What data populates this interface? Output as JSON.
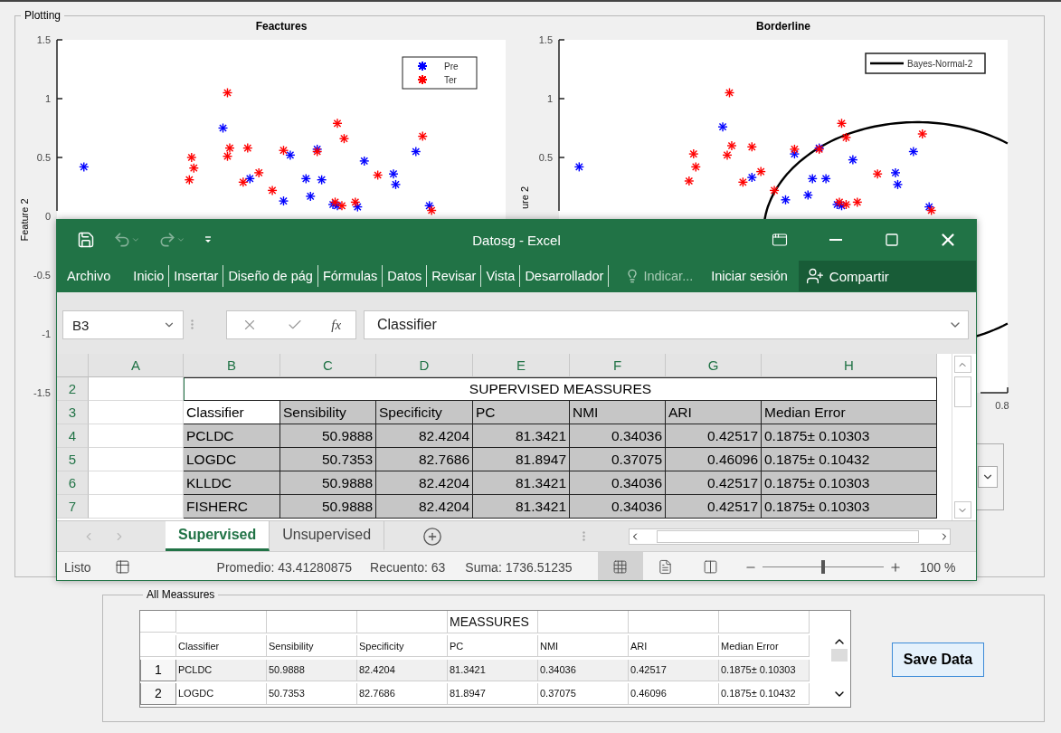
{
  "plotting": {
    "legend": "Plotting",
    "plots": [
      {
        "title": "Feactures",
        "ylabel": "Feature 2",
        "yticks": [
          "1.5",
          "1",
          "0.5",
          "0",
          "-0.5",
          "-1",
          "-1.5"
        ],
        "legend": [
          {
            "kind": "marker",
            "label": "Pre",
            "color": "#0000ff"
          },
          {
            "kind": "marker",
            "label": "Ter",
            "color": "#ff0000"
          }
        ]
      },
      {
        "title": "Borderline",
        "ylabel": "ure 2",
        "yticks": [
          "1.5",
          "1",
          "0.5"
        ],
        "xtick": "0.8",
        "legend": [
          {
            "kind": "line",
            "label": "Bayes-Normal-2"
          }
        ]
      }
    ]
  },
  "excel": {
    "title": "Datosg - Excel",
    "ribbon_tabs": [
      "Inicio",
      "Insertar",
      "Diseño de pág",
      "Fórmulas",
      "Datos",
      "Revisar",
      "Vista",
      "Desarrollador"
    ],
    "file_tab": "Archivo",
    "tell_me": "Indicar...",
    "sign_in": "Iniciar sesión",
    "share": "Compartir",
    "name_box": "B3",
    "function_label": "fx",
    "formula": "Classifier",
    "columns": [
      "A",
      "B",
      "C",
      "D",
      "E",
      "F",
      "G",
      "H"
    ],
    "rows": [
      {
        "kind": "title",
        "number": "2",
        "text": "SUPERVISED MEASSURES"
      },
      {
        "kind": "header",
        "number": "3",
        "cells": [
          {
            "text": "Classifier",
            "active": true
          },
          {
            "text": "Sensibility",
            "active": false
          },
          {
            "text": "Specificity",
            "active": false
          },
          {
            "text": "PC",
            "active": false
          },
          {
            "text": "NMI",
            "active": false
          },
          {
            "text": "ARI",
            "active": false
          },
          {
            "text": "Median Error",
            "active": false
          }
        ]
      },
      {
        "kind": "data",
        "number": "4",
        "selected": true,
        "cells": [
          "PCLDC",
          "50.9888",
          "82.4204",
          "81.3421",
          "0.34036",
          "0.42517",
          "0.1875± 0.10303"
        ]
      },
      {
        "kind": "data",
        "number": "5",
        "selected": true,
        "cells": [
          "LOGDC",
          "50.7353",
          "82.7686",
          "81.8947",
          "0.37075",
          "0.46096",
          "0.1875± 0.10432"
        ]
      },
      {
        "kind": "data",
        "number": "6",
        "selected": true,
        "cells": [
          "KLLDC",
          "50.9888",
          "82.4204",
          "81.3421",
          "0.34036",
          "0.42517",
          "0.1875± 0.10303"
        ]
      },
      {
        "kind": "data",
        "number": "7",
        "selected": true,
        "cells": [
          "FISHERC",
          "50.9888",
          "82.4204",
          "81.3421",
          "0.34036",
          "0.42517",
          "0.1875± 0.10303"
        ]
      }
    ],
    "sheets": [
      {
        "label": "Supervised",
        "selected": true
      },
      {
        "label": "Unsupervised",
        "selected": false
      }
    ],
    "status": {
      "ready": "Listo",
      "average": "Promedio: 43.41280875",
      "count": "Recuento: 63",
      "sum": "Suma: 1736.51235",
      "zoom": "100 %",
      "zoom_slider": {
        "level": 0.5
      }
    },
    "views": [
      {
        "kind": "normal",
        "selected": true
      },
      {
        "kind": "page_layout",
        "selected": false
      },
      {
        "kind": "page_break",
        "selected": false
      }
    ]
  },
  "all_meassures": {
    "legend": "All Meassures",
    "group_header": "MEASSURES",
    "columns": [
      "Classifier",
      "Sensibility",
      "Specificity",
      "PC",
      "NMI",
      "ARI",
      "Median Error"
    ],
    "rows": [
      {
        "number": "1",
        "cells": [
          "PCLDC",
          "50.9888",
          "82.4204",
          "81.3421",
          "0.34036",
          "0.42517",
          "0.1875± 0.10303"
        ]
      },
      {
        "number": "2",
        "cells": [
          "LOGDC",
          "50.7353",
          "82.7686",
          "81.8947",
          "0.37075",
          "0.46096",
          "0.1875± 0.10432"
        ]
      }
    ]
  },
  "save_button": "Save Data"
}
